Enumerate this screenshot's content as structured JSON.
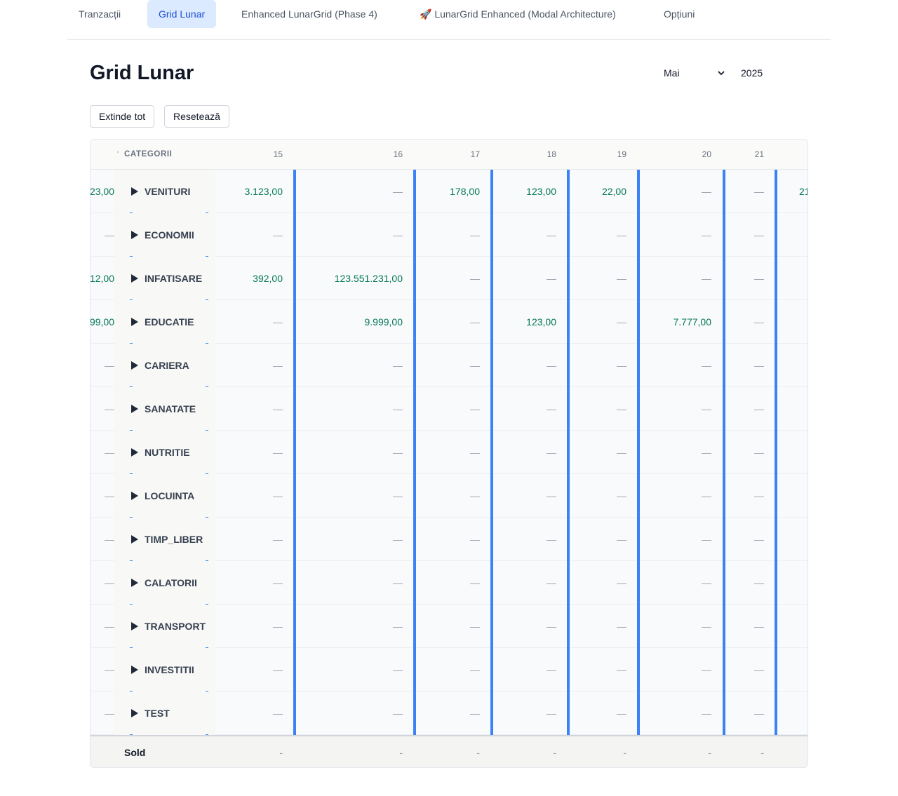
{
  "nav": {
    "tabs": [
      {
        "label": "Tranzacții",
        "active": false
      },
      {
        "label": "Grid Lunar",
        "active": true
      },
      {
        "label": "Enhanced LunarGrid (Phase 4)",
        "active": false
      },
      {
        "label": "🚀 LunarGrid Enhanced (Modal Architecture)",
        "active": false
      },
      {
        "label": "Opțiuni",
        "active": false
      }
    ]
  },
  "page": {
    "title": "Grid Lunar",
    "month": "Mai",
    "year": "2025"
  },
  "toolbar": {
    "expand_label": "Extinde tot",
    "reset_label": "Resetează"
  },
  "grid": {
    "category_header": "CATEGORII",
    "day_headers": [
      "15",
      "16",
      "17",
      "18",
      "19",
      "20",
      "21"
    ],
    "rows": [
      {
        "name": "VENITURI",
        "left": "23,00",
        "values": [
          "3.123,00",
          "—",
          "178,00",
          "123,00",
          "22,00",
          "—",
          "—"
        ],
        "right": "21"
      },
      {
        "name": "ECONOMII",
        "left": "—",
        "values": [
          "—",
          "—",
          "—",
          "—",
          "—",
          "—",
          "—"
        ],
        "right": ""
      },
      {
        "name": "INFATISARE",
        "left": "12,00",
        "values": [
          "392,00",
          "123.551.231,00",
          "—",
          "—",
          "—",
          "—",
          "—"
        ],
        "right": ""
      },
      {
        "name": "EDUCATIE",
        "left": "99,00",
        "values": [
          "—",
          "9.999,00",
          "—",
          "123,00",
          "—",
          "7.777,00",
          "—"
        ],
        "right": ""
      },
      {
        "name": "CARIERA",
        "left": "—",
        "values": [
          "—",
          "—",
          "—",
          "—",
          "—",
          "—",
          "—"
        ],
        "right": ""
      },
      {
        "name": "SANATATE",
        "left": "—",
        "values": [
          "—",
          "—",
          "—",
          "—",
          "—",
          "—",
          "—"
        ],
        "right": ""
      },
      {
        "name": "NUTRITIE",
        "left": "—",
        "values": [
          "—",
          "—",
          "—",
          "—",
          "—",
          "—",
          "—"
        ],
        "right": ""
      },
      {
        "name": "LOCUINTA",
        "left": "—",
        "values": [
          "—",
          "—",
          "—",
          "—",
          "—",
          "—",
          "—"
        ],
        "right": ""
      },
      {
        "name": "TIMP_LIBER",
        "left": "—",
        "values": [
          "—",
          "—",
          "—",
          "—",
          "—",
          "—",
          "—"
        ],
        "right": ""
      },
      {
        "name": "CALATORII",
        "left": "—",
        "values": [
          "—",
          "—",
          "—",
          "—",
          "—",
          "—",
          "—"
        ],
        "right": ""
      },
      {
        "name": "TRANSPORT",
        "left": "—",
        "values": [
          "—",
          "—",
          "—",
          "—",
          "—",
          "—",
          "—"
        ],
        "right": ""
      },
      {
        "name": "INVESTITII",
        "left": "—",
        "values": [
          "—",
          "—",
          "—",
          "—",
          "—",
          "—",
          "—"
        ],
        "right": ""
      },
      {
        "name": "TEST",
        "left": "—",
        "values": [
          "—",
          "—",
          "—",
          "—",
          "—",
          "—",
          "—"
        ],
        "right": ""
      }
    ],
    "footer_label": "Sold",
    "footer_values": [
      "-",
      "-",
      "-",
      "-",
      "-",
      "-",
      "-"
    ]
  },
  "colors": {
    "accent": "#3b82f6",
    "value_green": "#047857",
    "active_tab_bg": "#dbeafe"
  }
}
